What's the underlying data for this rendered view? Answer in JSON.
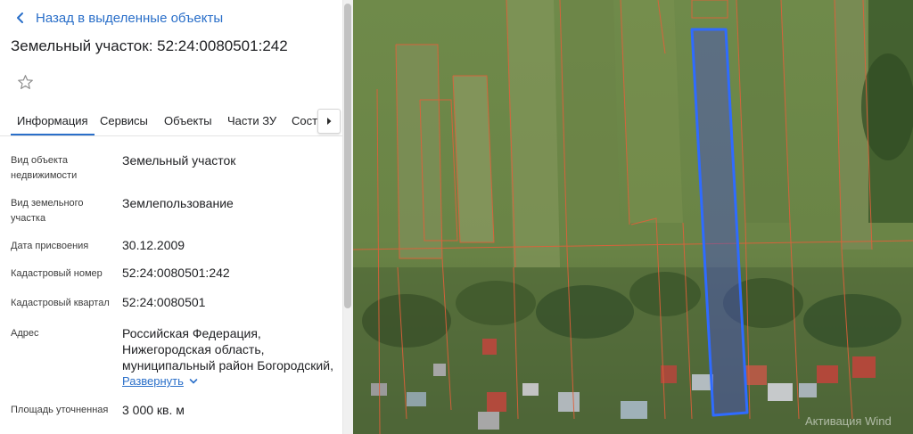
{
  "header": {
    "back_label": "Назад в выделенные объекты",
    "title": "Земельный участок: 52:24:0080501:242"
  },
  "tabs": [
    {
      "label": "Информация",
      "active": true
    },
    {
      "label": "Сервисы"
    },
    {
      "label": "Объекты"
    },
    {
      "label": "Части ЗУ"
    },
    {
      "label": "Соста"
    }
  ],
  "info": {
    "object_type": {
      "label": "Вид объекта недвижимости",
      "value": "Земельный участок"
    },
    "land_type": {
      "label": "Вид земельного участка",
      "value": "Землепользование"
    },
    "date": {
      "label": "Дата присвоения",
      "value": "30.12.2009"
    },
    "cad_number": {
      "label": "Кадастровый номер",
      "value": "52:24:0080501:242"
    },
    "cad_quarter": {
      "label": "Кадастровый квартал",
      "value": "52:24:0080501"
    },
    "address": {
      "label": "Адрес",
      "line1": "Российская Федерация,",
      "line2": "Нижегородская область,",
      "line3": "муниципальный район Богородский,",
      "expand_label": "Развернуть"
    },
    "area": {
      "label": "Площадь уточненная",
      "value": "3 000 кв. м"
    }
  },
  "map": {
    "watermark": "Активация Wind",
    "highlight_color": "#2f6bff",
    "boundary_color": "#e0603a"
  }
}
